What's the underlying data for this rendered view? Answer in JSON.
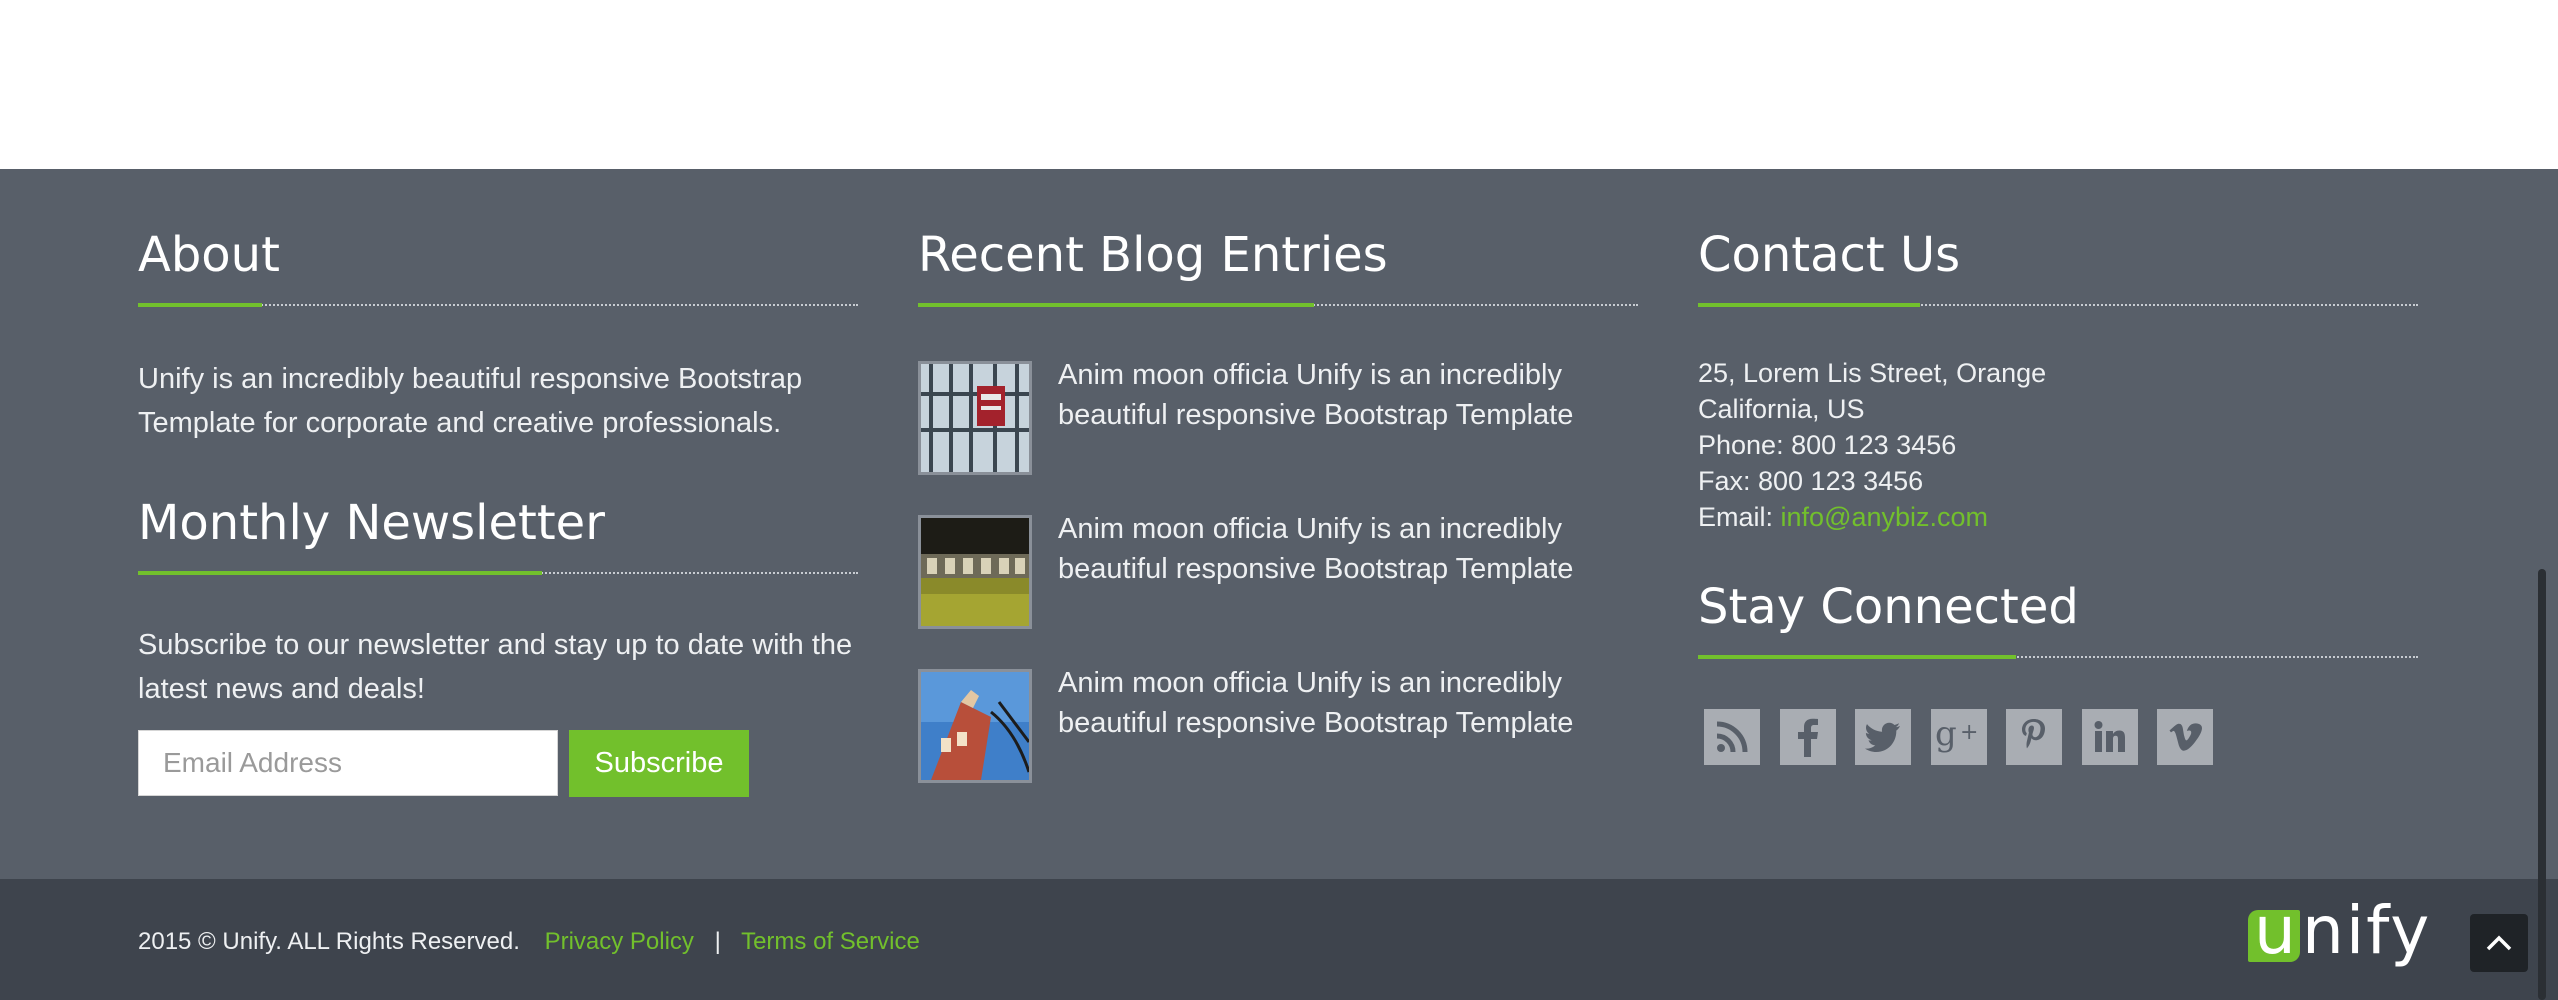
{
  "about": {
    "title": "About",
    "text": "Unify is an incredibly beautiful responsive Bootstrap Template for corporate and creative professionals."
  },
  "newsletter": {
    "title": "Monthly Newsletter",
    "text": "Subscribe to our newsletter and stay up to date with the latest news and deals!",
    "email_placeholder": "Email Address",
    "button_label": "Subscribe"
  },
  "blog": {
    "title": "Recent Blog Entries",
    "entries": [
      {
        "text": "Anim moon officia Unify is an incredibly beautiful responsive Bootstrap Template"
      },
      {
        "text": "Anim moon officia Unify is an incredibly beautiful responsive Bootstrap Template"
      },
      {
        "text": "Anim moon officia Unify is an incredibly beautiful responsive Bootstrap Template"
      }
    ]
  },
  "contact": {
    "title": "Contact Us",
    "address_line1": "25, Lorem Lis Street, Orange",
    "address_line2": "California, US",
    "phone": "Phone: 800 123 3456",
    "fax": "Fax: 800 123 3456",
    "email_label": "Email:",
    "email": "info@anybiz.com"
  },
  "social": {
    "title": "Stay Connected",
    "icons": [
      "rss-icon",
      "facebook-icon",
      "twitter-icon",
      "google-plus-icon",
      "pinterest-icon",
      "linkedin-icon",
      "vimeo-icon"
    ]
  },
  "copyright": {
    "text": "2015 © Unify. ALL Rights Reserved.",
    "privacy": "Privacy Policy",
    "separator": "|",
    "terms": "Terms of Service"
  },
  "logo": {
    "first": "u",
    "rest": "nify"
  },
  "colors": {
    "footer_bg": "#585f69",
    "copyright_bg": "#3e444d",
    "accent": "#72c02c",
    "social_icon_bg": "#a9adb3"
  }
}
